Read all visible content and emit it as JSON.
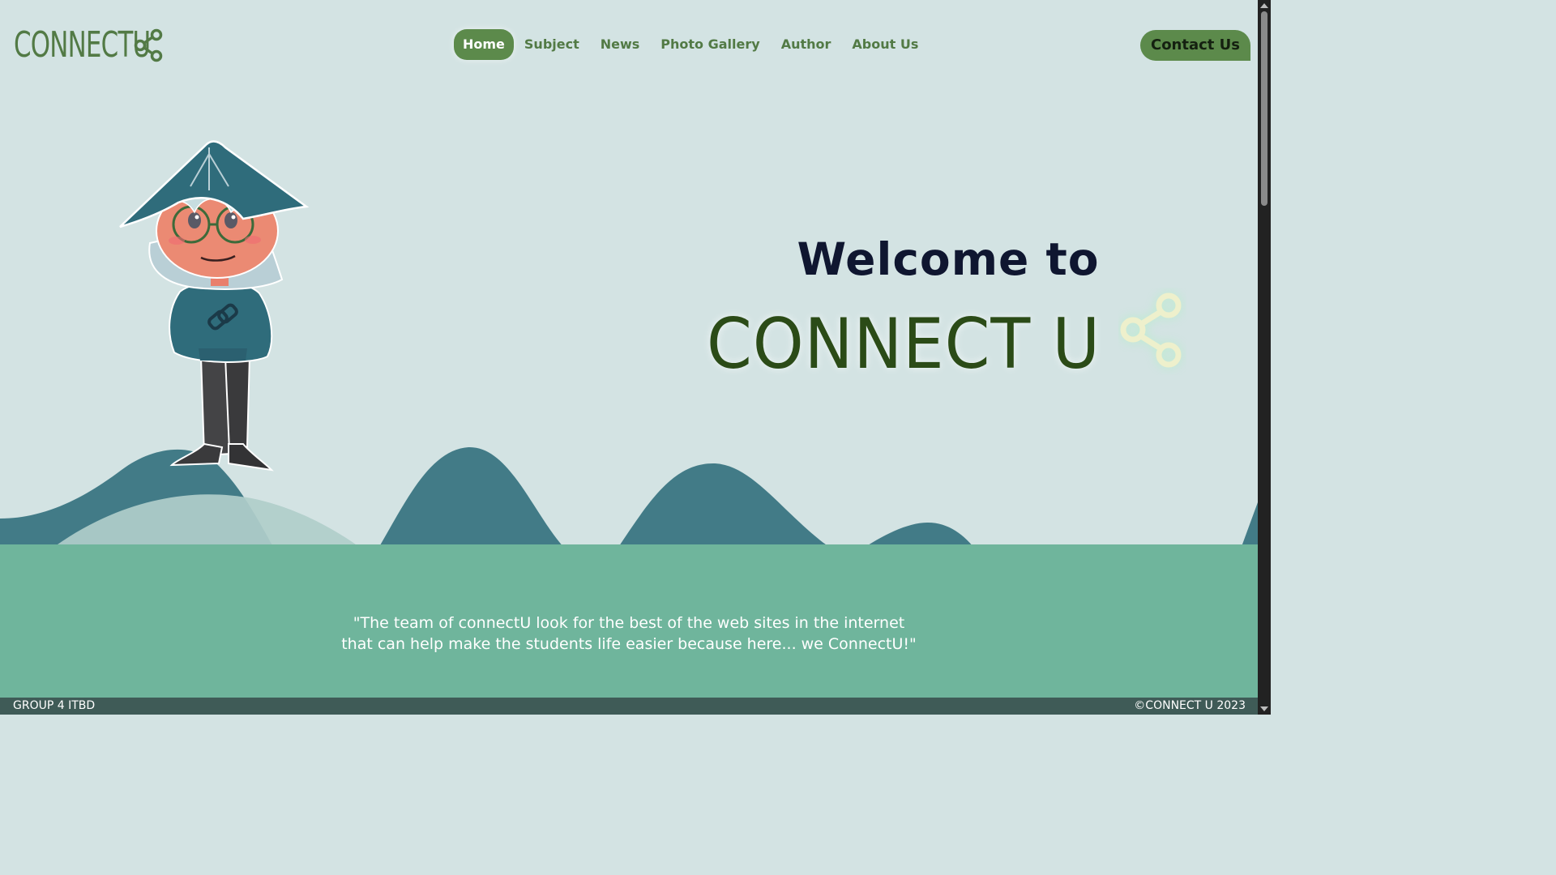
{
  "header": {
    "logo_text": "CONNECTU",
    "logo_icon": "share-icon",
    "nav": [
      {
        "label": "Home",
        "active": true
      },
      {
        "label": "Subject",
        "active": false
      },
      {
        "label": "News",
        "active": false
      },
      {
        "label": "Photo Gallery",
        "active": false
      },
      {
        "label": "Author",
        "active": false
      },
      {
        "label": "About Us",
        "active": false
      }
    ],
    "contact_label": "Contact Us"
  },
  "hero": {
    "welcome": "Welcome to",
    "brand": "CONNECT U",
    "brand_icon": "share-icon",
    "illustration": "chibi-character-mascot"
  },
  "quote": {
    "line1": "\"The team of connectU look for the best of the web sites in the internet",
    "line2": "that can help make the students life easier because here... we ConnectU!\""
  },
  "footer": {
    "left": "GROUP 4 ITBD",
    "right": "©CONNECT U 2023"
  },
  "colors": {
    "background": "#d3e3e3",
    "accent_green": "#5c8a4b",
    "brand_dark_green": "#2b4b17",
    "hill_teal": "#427b87",
    "band_green": "#6fb59c",
    "footer_bg": "#3f5b57"
  }
}
